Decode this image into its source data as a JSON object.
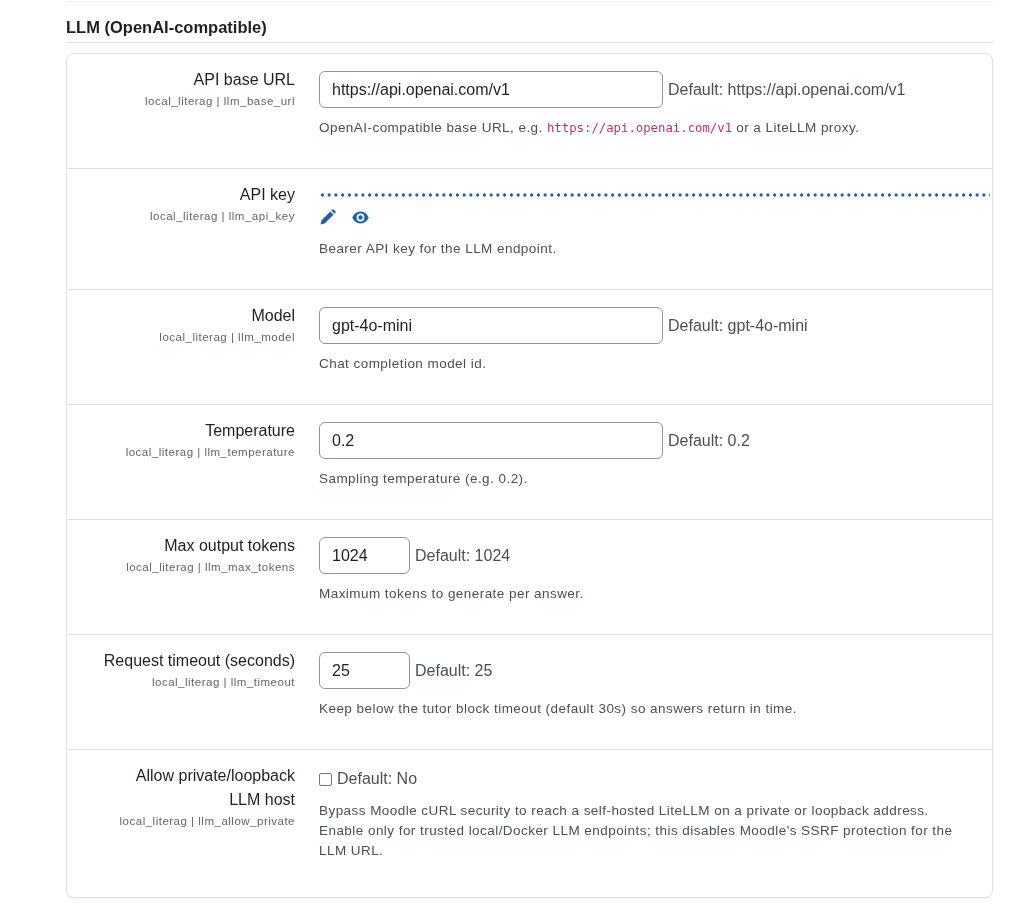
{
  "section": {
    "title": "LLM (OpenAI-compatible)"
  },
  "settings": [
    {
      "kind": "text",
      "label": "API base URL",
      "setting_id": "local_literag | llm_base_url",
      "value": "https://api.openai.com/v1",
      "default": "Default: https://api.openai.com/v1",
      "description": [
        {
          "kind": "plain",
          "text": "OpenAI-compatible base URL, e.g. "
        },
        {
          "kind": "code",
          "text": "https://api.openai.com/v1"
        },
        {
          "kind": "plain",
          "text": " or a LiteLLM proxy."
        }
      ]
    },
    {
      "kind": "password",
      "label": "API key",
      "setting_id": "local_literag | llm_api_key",
      "description": [
        {
          "kind": "plain",
          "text": "Bearer API key for the LLM endpoint."
        }
      ]
    },
    {
      "kind": "text",
      "label": "Model",
      "setting_id": "local_literag | llm_model",
      "value": "gpt-4o-mini",
      "default": "Default: gpt-4o-mini",
      "description": [
        {
          "kind": "plain",
          "text": "Chat completion model id."
        }
      ]
    },
    {
      "kind": "text",
      "label": "Temperature",
      "setting_id": "local_literag | llm_temperature",
      "value": "0.2",
      "default": "Default: 0.2",
      "description": [
        {
          "kind": "plain",
          "text": "Sampling temperature (e.g. 0.2)."
        }
      ]
    },
    {
      "kind": "number",
      "label": "Max output tokens",
      "setting_id": "local_literag | llm_max_tokens",
      "value": "1024",
      "default": "Default: 1024",
      "description": [
        {
          "kind": "plain",
          "text": "Maximum tokens to generate per answer."
        }
      ]
    },
    {
      "kind": "number",
      "label": "Request timeout (seconds)",
      "setting_id": "local_literag | llm_timeout",
      "value": "25",
      "default": "Default: 25",
      "description": [
        {
          "kind": "plain",
          "text": "Keep below the tutor block timeout (default 30s) so answers return in time."
        }
      ]
    },
    {
      "kind": "checkbox",
      "label": "Allow private/loopback LLM host",
      "setting_id": "local_literag | llm_allow_private",
      "checked": false,
      "default": "Default: No",
      "description": [
        {
          "kind": "plain",
          "text": "Bypass Moodle cURL security to reach a self-hosted LiteLLM on a private or loopback address. Enable only for trusted local/Docker LLM endpoints; this disables Moodle's SSRF protection for the LLM URL."
        }
      ]
    }
  ]
}
